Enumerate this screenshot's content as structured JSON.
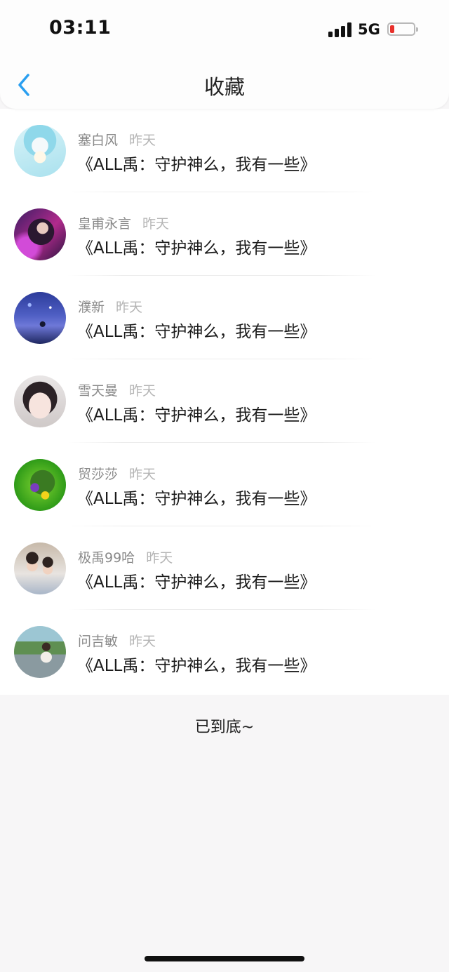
{
  "status_bar": {
    "time": "03:11",
    "network": "5G",
    "battery_level": 0.15,
    "battery_color": "#e8302b"
  },
  "nav": {
    "title": "收藏",
    "back_icon": "chevron-left-icon",
    "accent": "#2a9ff0"
  },
  "items": [
    {
      "user": "塞白风",
      "time": "昨天",
      "text": "《ALL禹：守护神么，我有一些》"
    },
    {
      "user": "皇甫永言",
      "time": "昨天",
      "text": "《ALL禹：守护神么，我有一些》"
    },
    {
      "user": "濮新",
      "time": "昨天",
      "text": "《ALL禹：守护神么，我有一些》"
    },
    {
      "user": "雪天曼",
      "time": "昨天",
      "text": "《ALL禹：守护神么，我有一些》"
    },
    {
      "user": "贸莎莎",
      "time": "昨天",
      "text": "《ALL禹：守护神么，我有一些》"
    },
    {
      "user": "极禹99哈",
      "time": "昨天",
      "text": "《ALL禹：守护神么，我有一些》"
    },
    {
      "user": "问吉敏",
      "time": "昨天",
      "text": "《ALL禹：守护神么，我有一些》"
    }
  ],
  "footer": {
    "end_text": "已到底~"
  }
}
